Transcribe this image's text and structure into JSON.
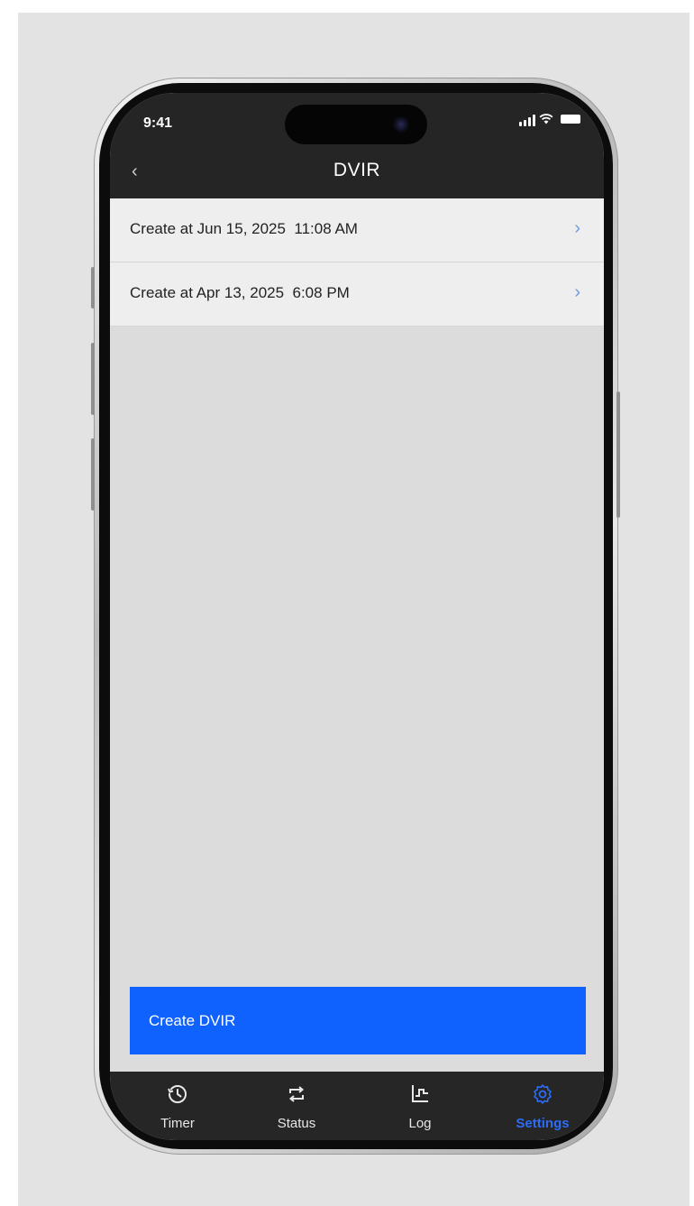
{
  "status_bar": {
    "time": "9:41",
    "icons": [
      "signal-icon",
      "wifi-icon",
      "battery-icon"
    ]
  },
  "nav": {
    "back_icon": "chevron-left-icon",
    "back_glyph": "‹",
    "title": "DVIR"
  },
  "list": {
    "items": [
      {
        "label": "Create at Jun 15, 2025  11:08 AM",
        "chevron": "›"
      },
      {
        "label": "Create at Apr 13, 2025  6:08 PM",
        "chevron": "›"
      }
    ]
  },
  "create_button": {
    "label": "Create DVIR"
  },
  "tabbar": {
    "tabs": [
      {
        "label": "Timer",
        "icon": "history-clock-icon"
      },
      {
        "label": "Status",
        "icon": "repeat-arrows-icon"
      },
      {
        "label": "Log",
        "icon": "step-graph-icon"
      },
      {
        "label": "Settings",
        "icon": "gear-icon",
        "active": true
      }
    ]
  },
  "colors": {
    "accent": "#0f62fe",
    "active_tab": "#2c6cf6",
    "header_bg": "#252525",
    "list_bg": "#eeeeee",
    "screen_bg": "#dcdcdc"
  }
}
